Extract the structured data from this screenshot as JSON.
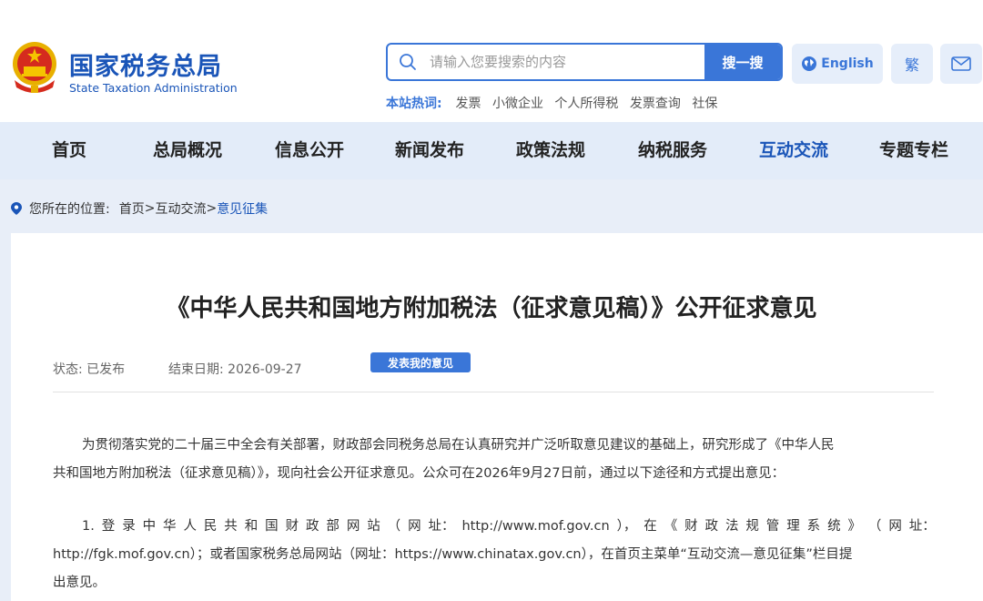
{
  "site": {
    "name_cn": "国家税务总局",
    "name_en": "State Taxation Administration"
  },
  "search": {
    "placeholder": "请输入您要搜索的内容",
    "button": "搜一搜"
  },
  "header_buttons": {
    "english": "English",
    "traditional": "繁"
  },
  "hot": {
    "label": "本站热词:",
    "items": [
      "发票",
      "小微企业",
      "个人所得税",
      "发票查询",
      "社保"
    ]
  },
  "nav": {
    "items": [
      {
        "label": "首页"
      },
      {
        "label": "总局概况"
      },
      {
        "label": "信息公开"
      },
      {
        "label": "新闻发布"
      },
      {
        "label": "政策法规"
      },
      {
        "label": "纳税服务"
      },
      {
        "label": "互动交流"
      },
      {
        "label": "专题专栏"
      }
    ],
    "active_label": "互动交流"
  },
  "breadcrumb": {
    "prefix": "您所在的位置:",
    "home": "首页",
    "sep": ">",
    "section": "互动交流",
    "current": "意见征集"
  },
  "article": {
    "title": "《中华人民共和国地方附加税法（征求意见稿）》公开征求意见",
    "status_label": "状态:",
    "status_value": "已发布",
    "end_label": "结束日期:",
    "end_value": "2026-09-27",
    "opinion_button": "发表我的意见",
    "para1_line1": "为贯彻落实党的二十届三中全会有关部署，财政部会同税务总局在认真研究并广泛听取意见建议的基础上，研究形成了《中华人民",
    "para1_line2": "共和国地方附加税法（征求意见稿）》，现向社会公开征求意见。公众可在2026年9月27日前，通过以下途径和方式提出意见：",
    "para2_line1_parts": [
      "1.",
      "登",
      "录",
      "中",
      "华",
      "人",
      "民",
      "共",
      "和",
      "国",
      "财",
      "政",
      "部",
      "网",
      "站",
      "（",
      "网",
      "址：",
      "http://www.mof.gov.cn",
      "），",
      "在",
      "《",
      "财",
      "政",
      "法",
      "规",
      "管",
      "理",
      "系",
      "统",
      "》",
      "（",
      "网",
      "址："
    ],
    "para2_line2": "http://fgk.mof.gov.cn）；或者国家税务总局网站（网址：https://www.chinatax.gov.cn），在首页主菜单“互动交流—意见征集”栏目提",
    "para2_line3": "出意见。"
  },
  "colors": {
    "brand_blue": "#1a55b8",
    "accent_blue": "#3a76d8",
    "nav_bg": "#e3ecf9"
  }
}
